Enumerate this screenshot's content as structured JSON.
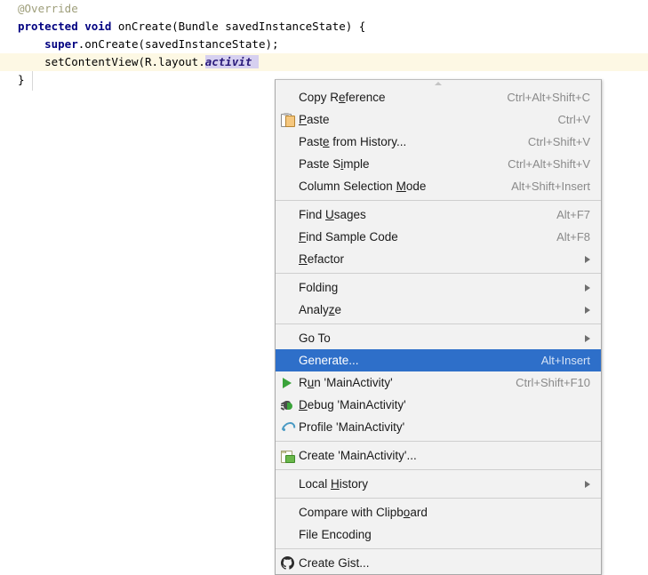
{
  "editor": {
    "lines": [
      {
        "indent": 1,
        "current": false,
        "tokens": [
          {
            "t": "@Override",
            "c": "annot"
          }
        ]
      },
      {
        "indent": 1,
        "current": false,
        "tokens": [
          {
            "t": "protected void",
            "c": "kw"
          },
          {
            "t": " onCreate(Bundle savedInstanceState) {",
            "c": "plain"
          }
        ]
      },
      {
        "indent": 2,
        "current": false,
        "tokens": [
          {
            "t": "super",
            "c": "kw"
          },
          {
            "t": ".onCreate(savedInstanceState);",
            "c": "plain"
          }
        ]
      },
      {
        "indent": 2,
        "current": true,
        "tokens": [
          {
            "t": "setContentView(R.layout.",
            "c": "plain"
          },
          {
            "t": "activit",
            "c": "sel"
          }
        ]
      },
      {
        "indent": 1,
        "current": false,
        "tokens": [
          {
            "t": "}",
            "c": "plain"
          }
        ]
      }
    ]
  },
  "context_menu": {
    "name": "editor-context-menu",
    "groups": [
      {
        "items": [
          {
            "label": "Copy Reference",
            "mnemonic_index": 6,
            "accel": "Ctrl+Alt+Shift+C",
            "icon": "none",
            "submenu": false,
            "selected": false
          },
          {
            "label": "Paste",
            "mnemonic_index": 0,
            "accel": "Ctrl+V",
            "icon": "paste-icon",
            "submenu": false,
            "selected": false
          },
          {
            "label": "Paste from History...",
            "mnemonic_index": 4,
            "accel": "Ctrl+Shift+V",
            "icon": "none",
            "submenu": false,
            "selected": false
          },
          {
            "label": "Paste Simple",
            "mnemonic_index": 7,
            "accel": "Ctrl+Alt+Shift+V",
            "icon": "none",
            "submenu": false,
            "selected": false
          },
          {
            "label": "Column Selection Mode",
            "mnemonic_index": 17,
            "accel": "Alt+Shift+Insert",
            "icon": "none",
            "submenu": false,
            "selected": false
          }
        ]
      },
      {
        "items": [
          {
            "label": "Find Usages",
            "mnemonic_index": 5,
            "accel": "Alt+F7",
            "icon": "none",
            "submenu": false,
            "selected": false
          },
          {
            "label": "Find Sample Code",
            "mnemonic_index": 0,
            "accel": "Alt+F8",
            "icon": "none",
            "submenu": false,
            "selected": false
          },
          {
            "label": "Refactor",
            "mnemonic_index": 0,
            "accel": "",
            "icon": "none",
            "submenu": true,
            "selected": false
          }
        ]
      },
      {
        "items": [
          {
            "label": "Folding",
            "mnemonic_index": -1,
            "accel": "",
            "icon": "none",
            "submenu": true,
            "selected": false
          },
          {
            "label": "Analyze",
            "mnemonic_index": 5,
            "accel": "",
            "icon": "none",
            "submenu": true,
            "selected": false
          }
        ]
      },
      {
        "items": [
          {
            "label": "Go To",
            "mnemonic_index": -1,
            "accel": "",
            "icon": "none",
            "submenu": true,
            "selected": false
          },
          {
            "label": "Generate...",
            "mnemonic_index": -1,
            "accel": "Alt+Insert",
            "icon": "none",
            "submenu": false,
            "selected": true
          },
          {
            "label": "Run 'MainActivity'",
            "mnemonic_index": 1,
            "accel": "Ctrl+Shift+F10",
            "icon": "run-icon",
            "submenu": false,
            "selected": false
          },
          {
            "label": "Debug 'MainActivity'",
            "mnemonic_index": 0,
            "accel": "",
            "icon": "debug-icon",
            "submenu": false,
            "selected": false
          },
          {
            "label": "Profile 'MainActivity'",
            "mnemonic_index": -1,
            "accel": "",
            "icon": "profile-icon",
            "submenu": false,
            "selected": false
          }
        ]
      },
      {
        "items": [
          {
            "label": "Create 'MainActivity'...",
            "mnemonic_index": -1,
            "accel": "",
            "icon": "new-file-icon",
            "submenu": false,
            "selected": false
          }
        ]
      },
      {
        "items": [
          {
            "label": "Local History",
            "mnemonic_index": 6,
            "accel": "",
            "icon": "none",
            "submenu": true,
            "selected": false
          }
        ]
      },
      {
        "items": [
          {
            "label": "Compare with Clipboard",
            "mnemonic_index": 18,
            "accel": "",
            "icon": "none",
            "submenu": false,
            "selected": false
          },
          {
            "label": "File Encoding",
            "mnemonic_index": -1,
            "accel": "",
            "icon": "none",
            "submenu": false,
            "selected": false
          }
        ]
      },
      {
        "items": [
          {
            "label": "Create Gist...",
            "mnemonic_index": -1,
            "accel": "",
            "icon": "github-icon",
            "submenu": false,
            "selected": false
          }
        ]
      }
    ]
  },
  "colors": {
    "selection_highlight": "#2e6fc9",
    "menu_background": "#f2f2f2",
    "current_line": "#fdf8e4",
    "code_selection": "#d6d0f0",
    "keyword": "#000080",
    "annotation": "#9e9e7a",
    "accelerator_text": "#8a8a8a"
  }
}
